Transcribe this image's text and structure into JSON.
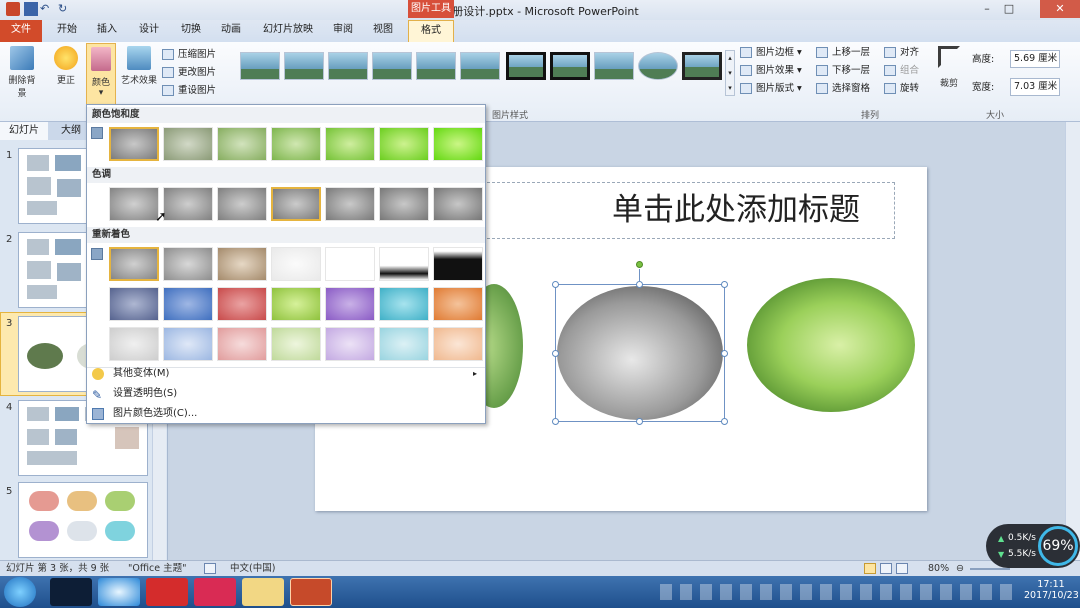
{
  "window": {
    "title": "画册设计.pptx - Microsoft PowerPoint",
    "context_tab": "图片工具"
  },
  "tabs": {
    "file": "文件",
    "home": "开始",
    "insert": "插入",
    "design": "设计",
    "transitions": "切换",
    "animations": "动画",
    "slideshow": "幻灯片放映",
    "review": "审阅",
    "view": "视图",
    "format": "格式"
  },
  "ribbon": {
    "remove_bg": "删除背景",
    "corrections": "更正",
    "color": "颜色",
    "artistic": "艺术效果",
    "compress": "压缩图片",
    "change": "更改图片",
    "reset": "重设图片",
    "border": "图片边框",
    "effects": "图片效果",
    "layout": "图片版式",
    "bring_forward": "上移一层",
    "send_backward": "下移一层",
    "selection_pane": "选择窗格",
    "align": "对齐",
    "group": "组合",
    "rotate": "旋转",
    "crop": "裁剪",
    "height_label": "高度:",
    "height_value": "5.69 厘米",
    "width_label": "宽度:",
    "width_value": "7.03 厘米",
    "group_styles": "图片样式",
    "group_arrange": "排列",
    "group_size": "大小"
  },
  "left_pane": {
    "tab_slides": "幻灯片",
    "tab_outline": "大纲",
    "slide_numbers": [
      "1",
      "2",
      "3",
      "4",
      "5"
    ]
  },
  "slide": {
    "title_placeholder": "单击此处添加标题"
  },
  "color_menu": {
    "saturation_header": "颜色饱和度",
    "tone_header": "色调",
    "recolor_header": "重新着色",
    "more_variations": "其他变体(M)",
    "set_transparent": "设置透明色(S)",
    "color_options": "图片颜色选项(C)..."
  },
  "status": {
    "slide_info": "幻灯片 第 3 张，共 9 张",
    "theme": "\"Office 主题\"",
    "language": "中文(中国)",
    "zoom": "80%"
  },
  "netmon": {
    "up": "0.5K/s",
    "down": "5.5K/s",
    "cpu": "69%"
  },
  "clock": {
    "time": "17:11",
    "date": "2017/10/23"
  }
}
